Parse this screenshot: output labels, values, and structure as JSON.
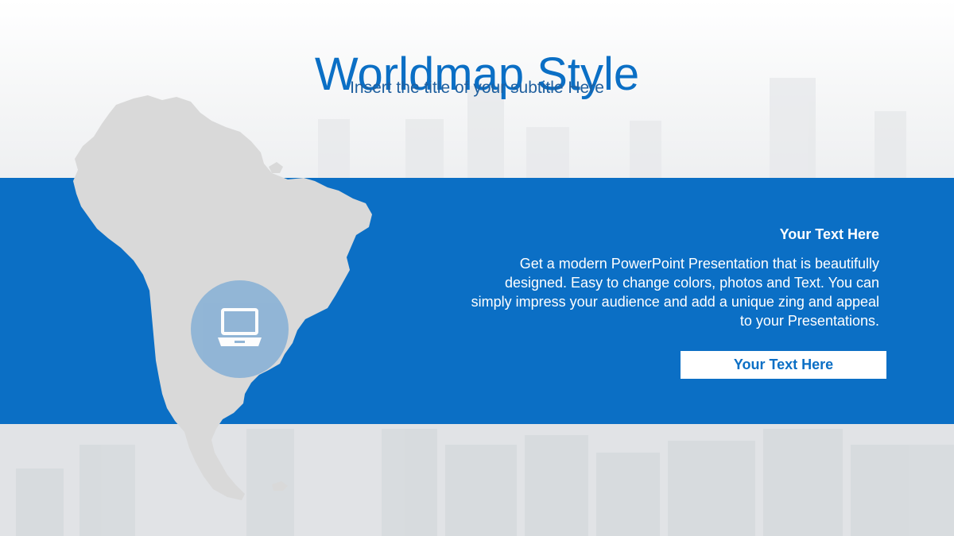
{
  "slide": {
    "title": "Worldmap Style",
    "subtitle": "Insert the title of your subtitle Here"
  },
  "map": {
    "region": "South America",
    "fill_color": "#d9d9d9"
  },
  "icon": {
    "name": "laptop-icon",
    "circle_color": "#8eb4d6",
    "glyph_color": "#ffffff"
  },
  "content": {
    "heading": "Your Text  Here",
    "body_lines": [
      "Get a modern PowerPoint  Presentation that is beautifully",
      "designed.  Easy to change colors, photos and Text. You can",
      "simply impress your audience and add a unique zing and appeal",
      "to your Presentations."
    ],
    "button_label": "Your Text  Here"
  },
  "colors": {
    "accent": "#0b6fc5",
    "title": "#0b6fc5",
    "subtitle": "#1f5f9e",
    "band": "#0b6fc5",
    "button_text": "#0b6fc5",
    "button_bg": "#ffffff",
    "body_text": "#ffffff"
  }
}
